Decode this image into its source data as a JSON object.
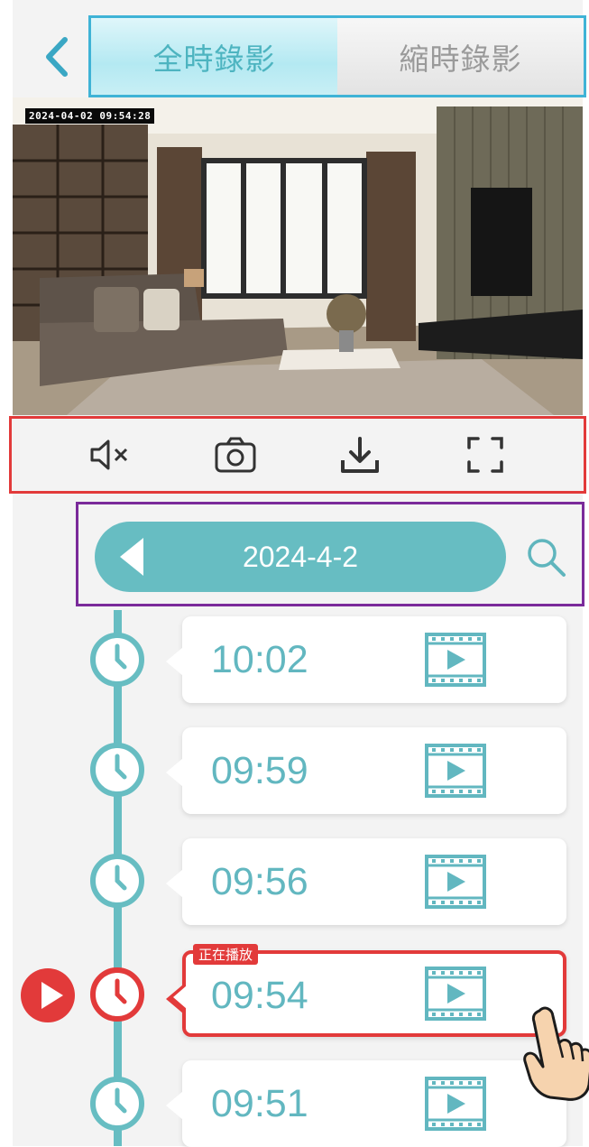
{
  "header": {
    "tabs": [
      {
        "label": "全時錄影",
        "active": true
      },
      {
        "label": "縮時錄影",
        "active": false
      }
    ]
  },
  "video": {
    "timestamp": "2024-04-02 09:54:28"
  },
  "toolbar": {
    "buttons": [
      "mute-icon",
      "snapshot-icon",
      "download-icon",
      "fullscreen-icon"
    ]
  },
  "date_selector": {
    "date": "2024-4-2"
  },
  "recordings": [
    {
      "time": "10:02",
      "playing": false
    },
    {
      "time": "09:59",
      "playing": false
    },
    {
      "time": "09:56",
      "playing": false
    },
    {
      "time": "09:54",
      "playing": true,
      "badge": "正在播放"
    },
    {
      "time": "09:51",
      "playing": false
    }
  ],
  "colors": {
    "accent": "#67bdc2",
    "highlight": "#e23a3a",
    "tab_border": "#3fb3d6",
    "date_border": "#7a2a9a"
  }
}
